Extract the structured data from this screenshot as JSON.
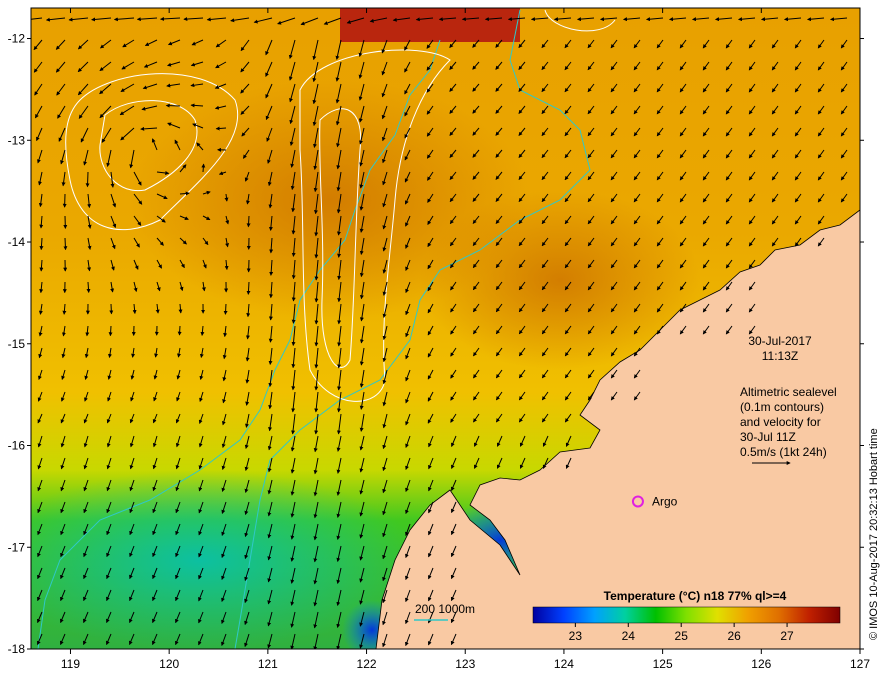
{
  "map": {
    "lon_range": [
      118.6,
      127.0
    ],
    "lat_range": [
      -18.0,
      -11.7
    ],
    "x_ticks": [
      "119",
      "120",
      "121",
      "122",
      "123",
      "124",
      "125",
      "126",
      "127"
    ],
    "y_ticks": [
      "-12",
      "-13",
      "-14",
      "-15",
      "-16",
      "-17",
      "-18"
    ]
  },
  "annotation": {
    "date": "30-Jul-2017",
    "time": "11:13Z",
    "altimetry_lines": [
      "Altimetric sealevel",
      "(0.1m contours)",
      "and velocity for",
      "30-Jul 11Z",
      "0.5m/s (1kt 24h)"
    ]
  },
  "argo": {
    "label": "Argo",
    "lon": 124.75,
    "lat": -16.55,
    "color": "#e020e0"
  },
  "bathymetry_legend": {
    "label": "200  1000m",
    "color": "#30c8c8"
  },
  "colorbar": {
    "title": "Temperature (°C) n18 77% ql>=4",
    "ticks": [
      "23",
      "24",
      "25",
      "26",
      "27"
    ],
    "range": [
      22.2,
      28.0
    ],
    "colors": [
      "#0000a0",
      "#0040ff",
      "#00a0ff",
      "#00d0a0",
      "#00c000",
      "#80e000",
      "#e0e000",
      "#f0a000",
      "#e07000",
      "#c02000",
      "#800000"
    ]
  },
  "credit": "© IMOS 10-Aug-2017 20:32:13 Hobart time",
  "colors": {
    "land": "#f9c9a3",
    "ocean_warm": "#e8a000",
    "ocean_mid": "#f0c000",
    "ocean_cool": "#20c020",
    "contour": "#ffffff",
    "isobath": "#30c8c8",
    "arrow": "#000000"
  }
}
